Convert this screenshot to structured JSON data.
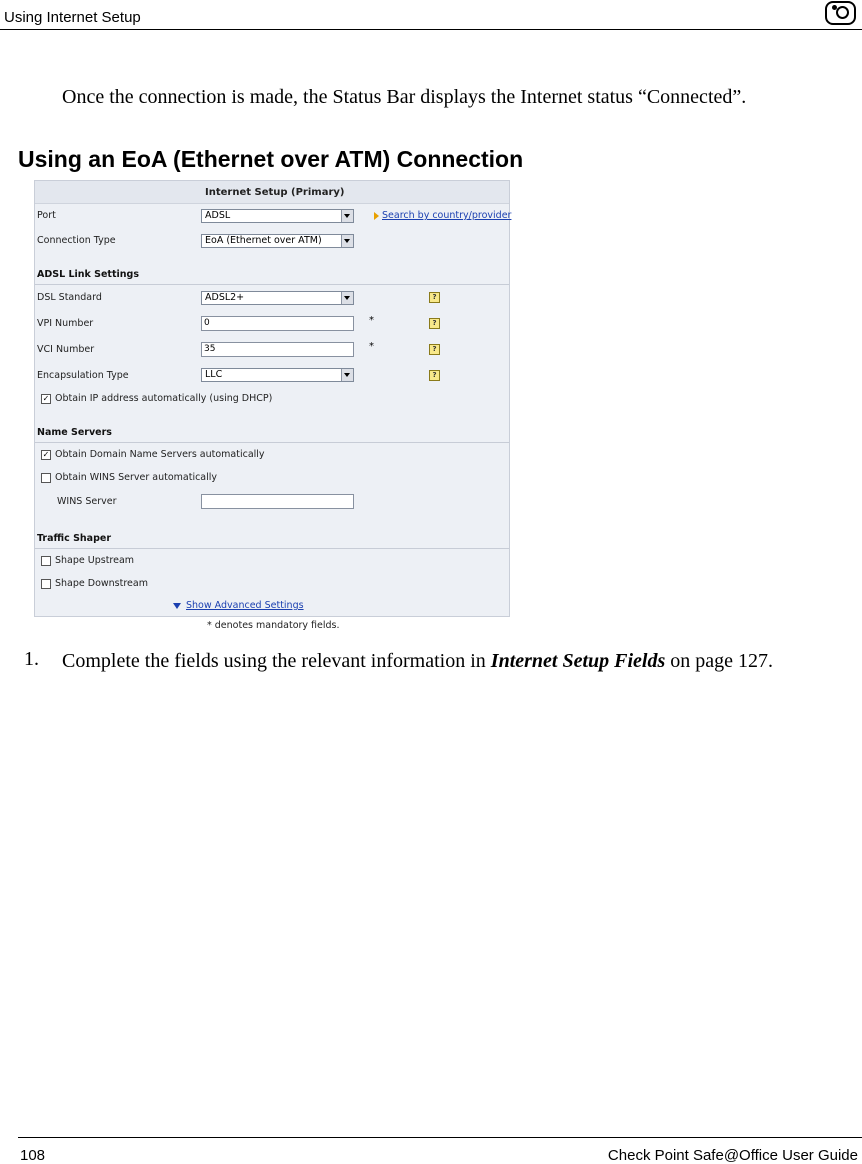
{
  "header": {
    "title": "Using Internet Setup"
  },
  "intro": "Once the connection is made, the Status Bar displays the Internet status “Connected”.",
  "section_title": "Using an EoA (Ethernet over ATM) Connection",
  "screenshot": {
    "panel_title": "Internet Setup (Primary)",
    "port_label": "Port",
    "port_value": "ADSL",
    "search_link": "Search by country/provider",
    "connection_type_label": "Connection Type",
    "connection_type_value": "EoA (Ethernet over ATM)",
    "adsl_section": "ADSL Link Settings",
    "dsl_standard_label": "DSL Standard",
    "dsl_standard_value": "ADSL2+",
    "vpi_label": "VPI Number",
    "vpi_value": "0",
    "vci_label": "VCI Number",
    "vci_value": "35",
    "encap_label": "Encapsulation Type",
    "encap_value": "LLC",
    "required_mark": "*",
    "help_glyph": "?",
    "obtain_ip_label": "Obtain IP address automatically (using DHCP)",
    "obtain_ip_checked": true,
    "name_servers_section": "Name Servers",
    "obtain_dns_label": "Obtain Domain Name Servers automatically",
    "obtain_dns_checked": true,
    "obtain_wins_label": "Obtain WINS Server automatically",
    "obtain_wins_checked": false,
    "wins_server_label": "WINS Server",
    "wins_server_value": "",
    "traffic_section": "Traffic Shaper",
    "shape_up_label": "Shape Upstream",
    "shape_up_checked": false,
    "shape_down_label": "Shape Downstream",
    "shape_down_checked": false,
    "advanced_link": "Show Advanced Settings",
    "footnote": "* denotes mandatory fields.",
    "check_glyph": "✓"
  },
  "step": {
    "number": "1.",
    "text_before": "Complete the fields using the relevant information in ",
    "emphasis": "Internet Setup Fields",
    "text_after": " on page 127."
  },
  "footer": {
    "page_number": "108",
    "guide_title": "Check Point Safe@Office User Guide"
  }
}
